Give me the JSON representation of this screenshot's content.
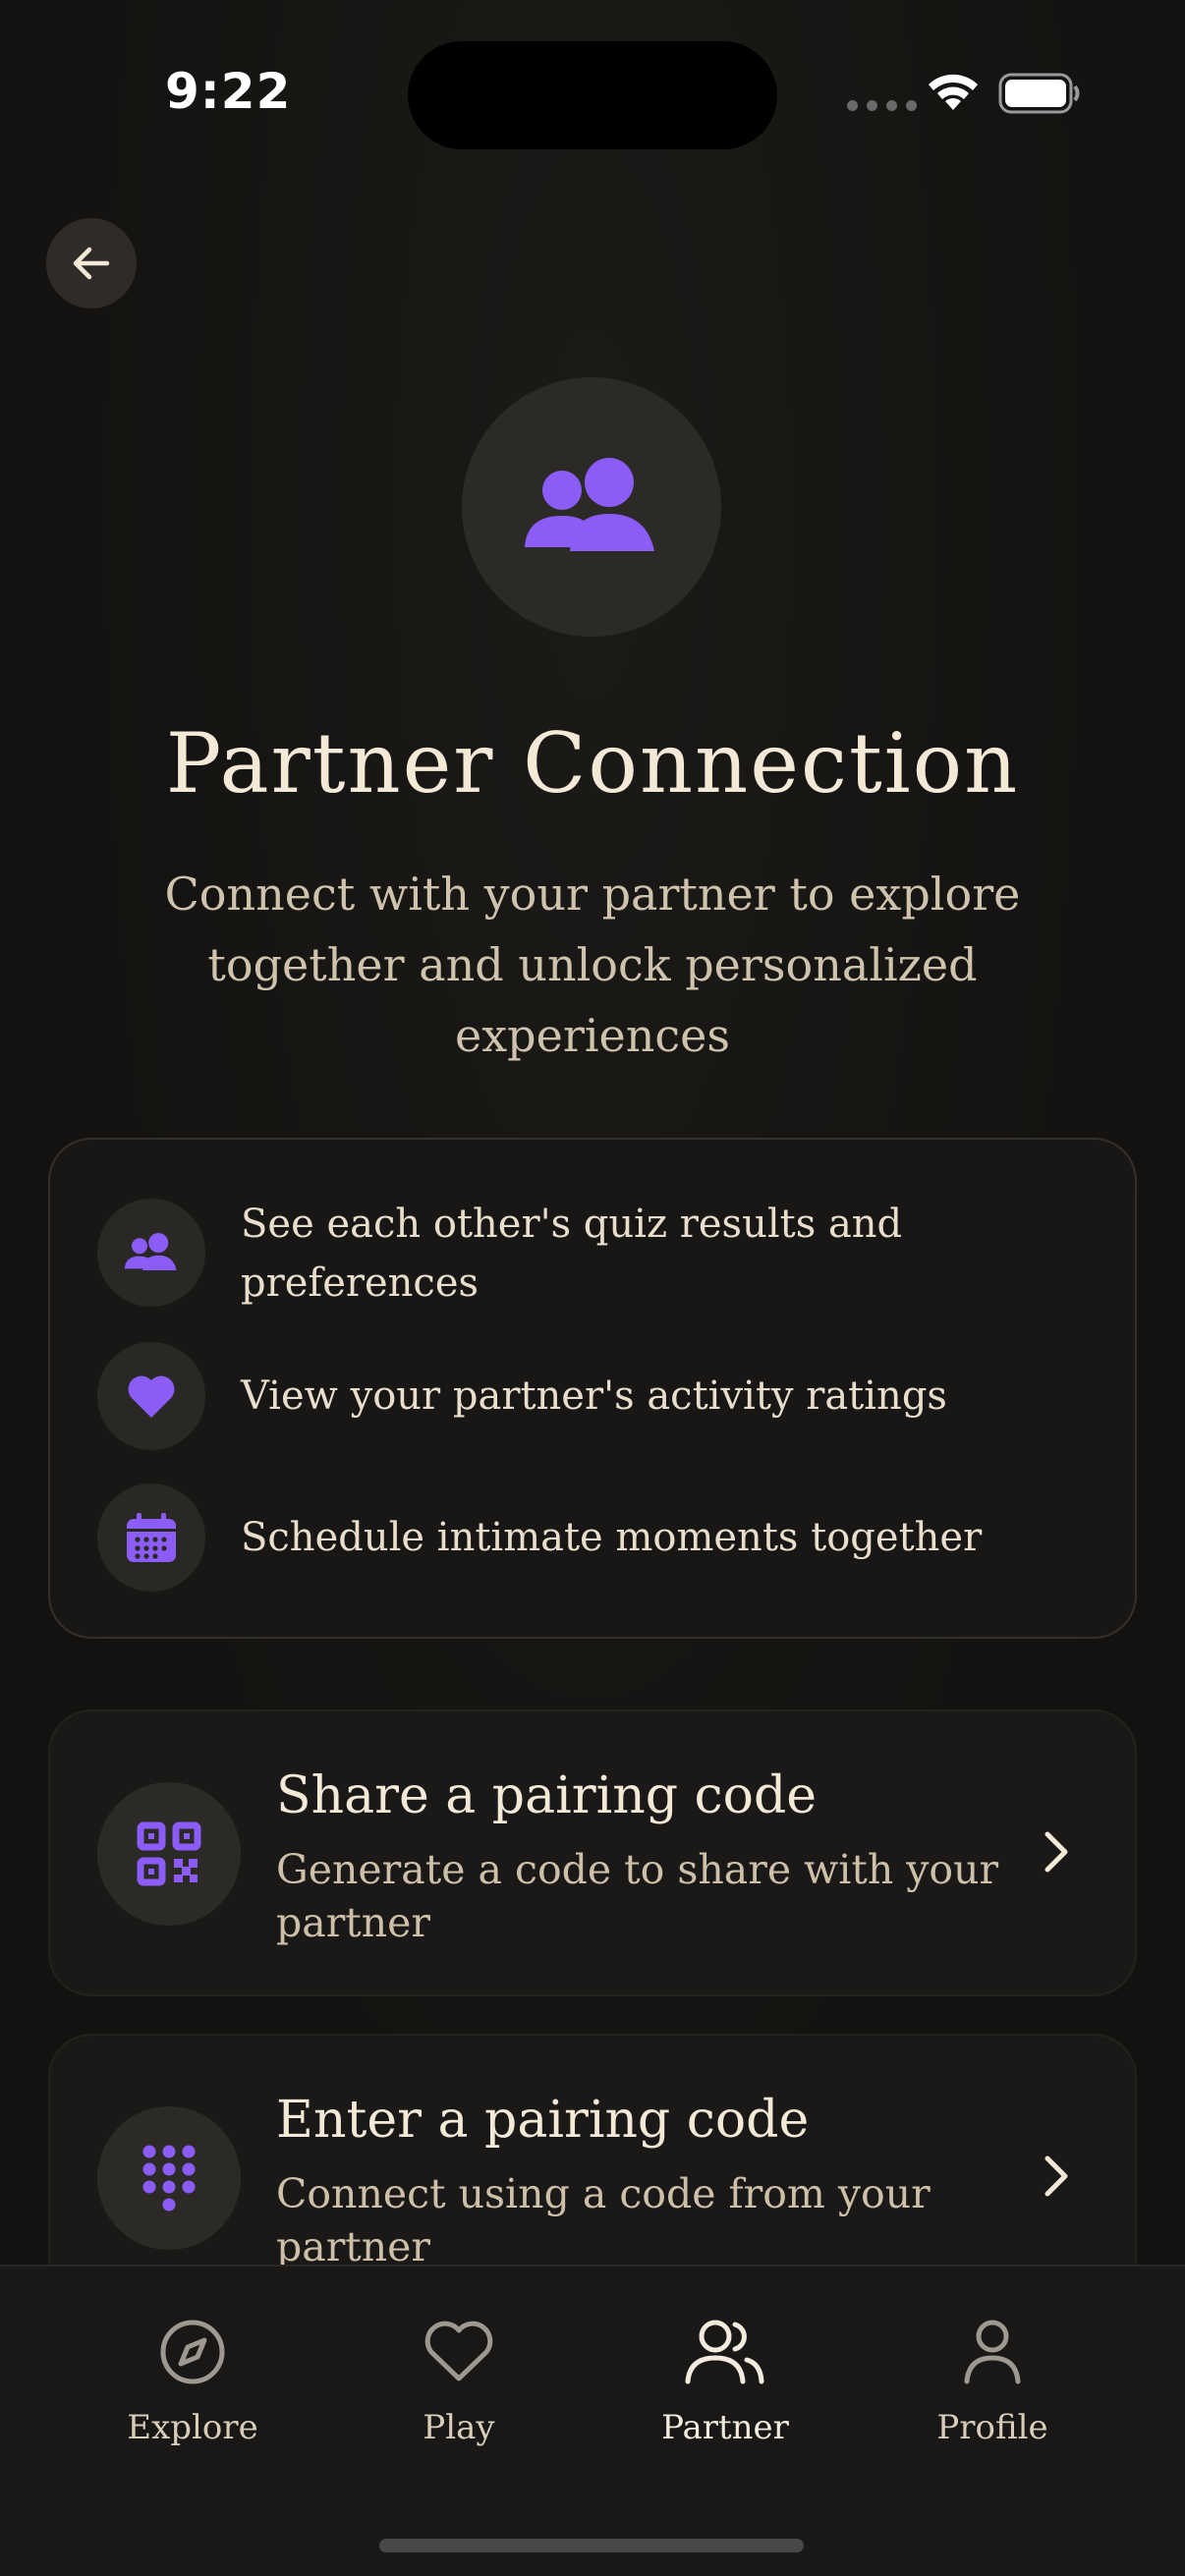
{
  "status_bar": {
    "time": "9:22"
  },
  "colors": {
    "accent": "#8b5cf6",
    "text": "#f3e9d6",
    "background": "#141311"
  },
  "header": {
    "back_icon": "arrow-left-icon"
  },
  "hero": {
    "icon": "users-icon",
    "title": "Partner Connection",
    "subtitle": "Connect with your partner to explore together and unlock personalized experiences"
  },
  "features": [
    {
      "icon": "users-icon",
      "text": "See each other's quiz results and preferences"
    },
    {
      "icon": "heart-icon",
      "text": "View your partner's activity ratings"
    },
    {
      "icon": "calendar-icon",
      "text": "Schedule intimate moments together"
    }
  ],
  "options": [
    {
      "icon": "qr-code-icon",
      "title": "Share a pairing code",
      "description": "Generate a code to share with your partner"
    },
    {
      "icon": "keypad-icon",
      "title": "Enter a pairing code",
      "description": "Connect using a code from your partner"
    }
  ],
  "nav": [
    {
      "icon": "compass-icon",
      "label": "Explore",
      "active": false
    },
    {
      "icon": "heart-outline-icon",
      "label": "Play",
      "active": false
    },
    {
      "icon": "users-outline-icon",
      "label": "Partner",
      "active": true
    },
    {
      "icon": "user-outline-icon",
      "label": "Profile",
      "active": false
    }
  ]
}
